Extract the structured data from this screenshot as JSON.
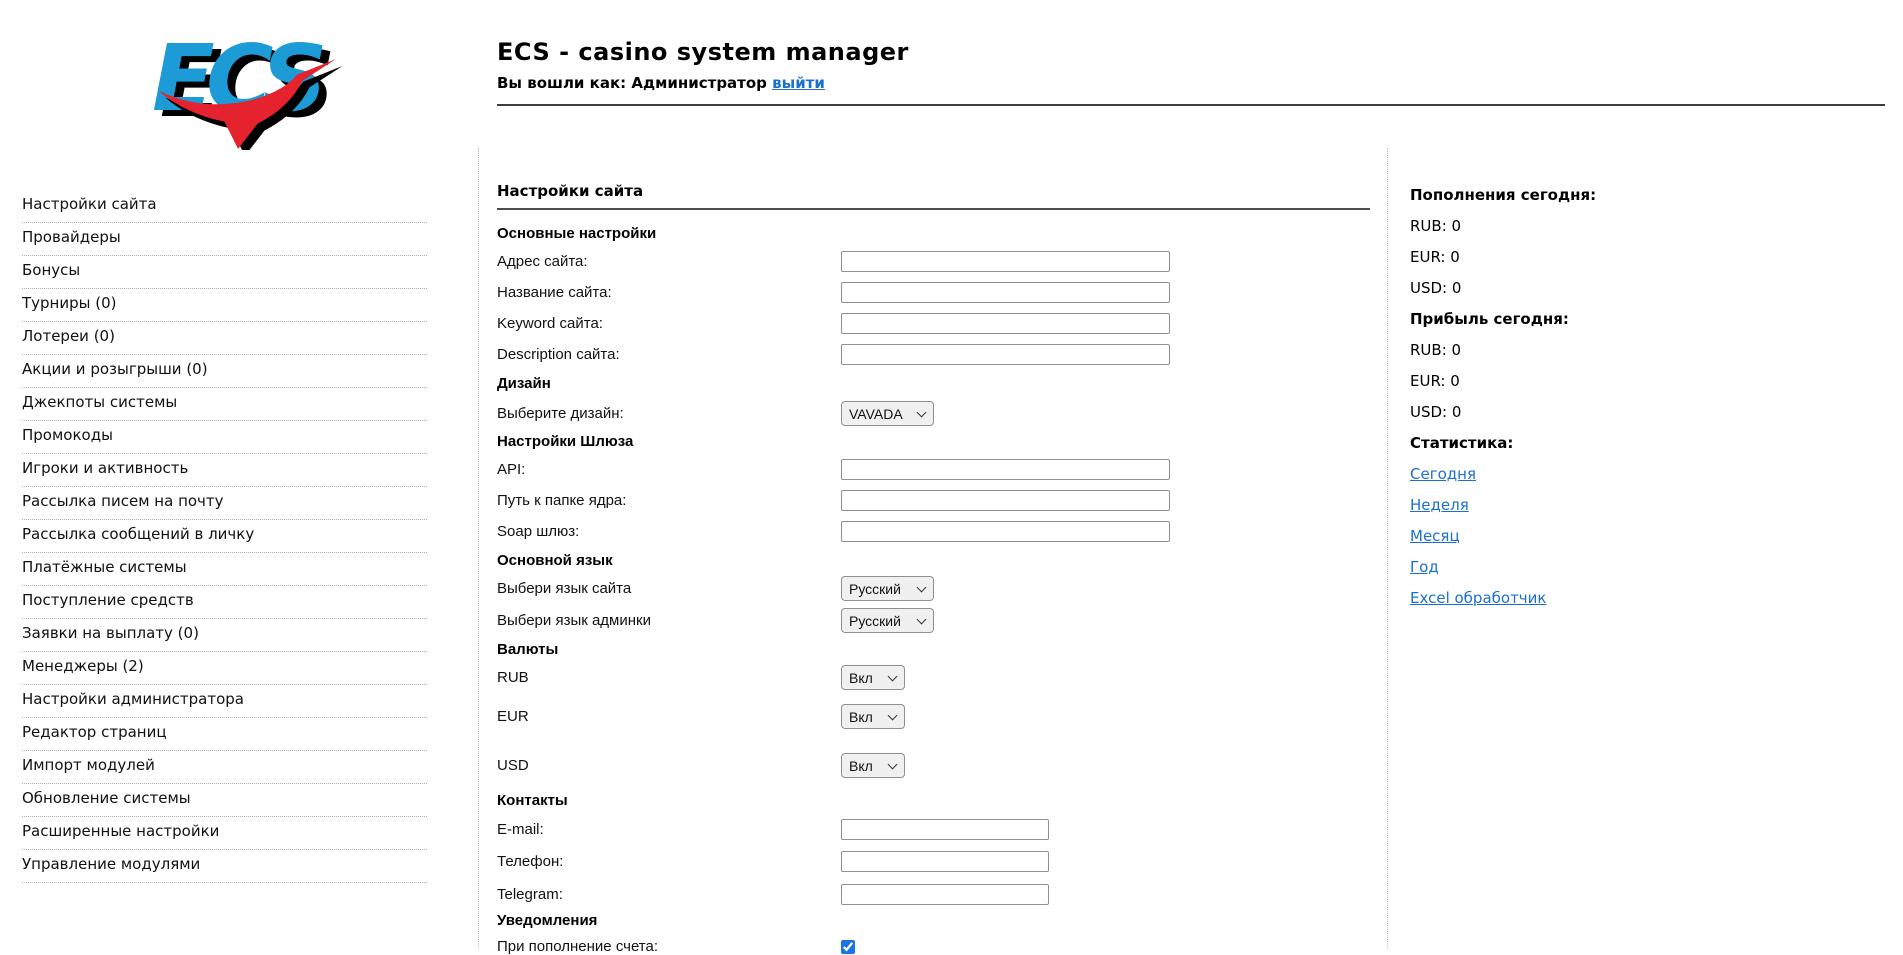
{
  "header": {
    "logo_text": "ECS",
    "title": "ECS - casino system manager",
    "login_prefix": "Вы вошли как: Администратор",
    "logout_label": "выйти"
  },
  "sidebar": {
    "items": [
      "Настройки сайта",
      "Провайдеры",
      "Бонусы",
      "Турниры (0)",
      "Лотереи (0)",
      "Акции и розыгрыши (0)",
      "Джекпоты системы",
      "Промокоды",
      "Игроки и активность",
      "Рассылка писем на почту",
      "Рассылка сообщений в личку",
      "Платёжные системы",
      "Поступление средств",
      "Заявки на выплату (0)",
      "Менеджеры (2)",
      "Настройки администратора",
      "Редактор страниц",
      "Импорт модулей",
      "Обновление системы",
      "Расширенные настройки",
      "Управление модулями"
    ]
  },
  "main": {
    "title": "Настройки сайта",
    "form": {
      "section_basic": "Основные настройки",
      "site_address_label": "Адрес сайта:",
      "site_name_label": "Название сайта:",
      "keyword_label": "Keyword сайта:",
      "description_label": "Description сайта:",
      "section_design": "Дизайн",
      "design_label": "Выберите дизайн:",
      "design_value": "VAVADA",
      "section_gateway": "Настройки Шлюза",
      "api_label": "API:",
      "core_path_label": "Путь к папке ядра:",
      "soap_label": "Soap шлюз:",
      "section_language": "Основной язык",
      "site_lang_label": "Выбери язык сайта",
      "site_lang_value": "Русский",
      "admin_lang_label": "Выбери язык админки",
      "admin_lang_value": "Русский",
      "section_currencies": "Валюты",
      "rub_label": "RUB",
      "rub_value": "Вкл",
      "eur_label": "EUR",
      "eur_value": "Вкл",
      "usd_label": "USD",
      "usd_value": "Вкл",
      "section_contacts": "Контакты",
      "email_label": "E-mail:",
      "phone_label": "Телефон:",
      "telegram_label": "Telegram:",
      "section_notifications": "Уведомления",
      "deposit_notify_label": "При пополнение счета:",
      "deposit_notify_checked": "checked"
    }
  },
  "stats": {
    "deposits_title": "Пополнения сегодня:",
    "deposits_rub": "RUB: 0",
    "deposits_eur": "EUR: 0",
    "deposits_usd": "USD: 0",
    "profit_title": "Прибыль сегодня:",
    "profit_rub": "RUB: 0",
    "profit_eur": "EUR: 0",
    "profit_usd": "USD: 0",
    "stats_title": "Статистика:",
    "links": [
      "Сегодня",
      "Неделя",
      "Месяц",
      "Год",
      "Excel обработчик"
    ]
  },
  "colors": {
    "link_blue": "#1b6fd2",
    "logo_blue": "#1d9bd7",
    "logo_red": "#e4232e",
    "checkbox_blue": "#1a73e8",
    "rule_dark": "#4d4d4d"
  }
}
